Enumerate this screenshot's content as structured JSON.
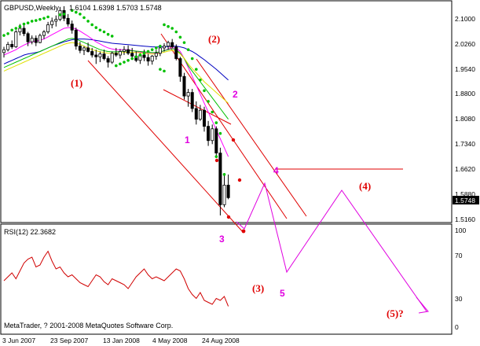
{
  "header": {
    "symbol": "GBPUSD,Weekly",
    "ohlc": "1.6104 1.6398 1.5703 1.5748"
  },
  "price_axis": {
    "ticks": [
      "2.1000",
      "2.0260",
      "1.9540",
      "1.8800",
      "1.8080",
      "1.7340",
      "1.6620",
      "1.5880",
      "1.5160"
    ],
    "current_price": "1.5748"
  },
  "rsi": {
    "label": "RSI(12) 22.3682",
    "ticks": [
      "100",
      "70",
      "30",
      "0"
    ]
  },
  "time_axis": {
    "labels": [
      "3 Jun 2007",
      "23 Sep 2007",
      "13 Jan 2008",
      "4 May 2008",
      "24 Aug 2008"
    ]
  },
  "copyright": "MetaTrader, ? 2001-2008 MetaQuotes Software Corp.",
  "wave_labels": {
    "red": [
      "(1)",
      "(2)",
      "(3)",
      "(4)",
      "(5)?"
    ],
    "magenta": [
      "1",
      "2",
      "3",
      "4",
      "5"
    ]
  },
  "colors": {
    "bull_candle": "#ffffff",
    "bear_candle": "#000000",
    "channel": "#e00000",
    "projection": "#e000e0",
    "sar": "#00c000",
    "rsi_line": "#d00000",
    "ma_blue": "#0000c0",
    "ma_magenta": "#ff00ff",
    "ma_green": "#00c000",
    "ma_yellow": "#e0e000",
    "current_price_box": "#000000"
  },
  "chart_data": {
    "type": "candlestick",
    "instrument": "GBPUSD",
    "timeframe": "Weekly",
    "last_bar": {
      "open": 1.6104,
      "high": 1.6398,
      "low": 1.5703,
      "close": 1.5748
    },
    "ylim": [
      1.505,
      2.125
    ],
    "candles": [
      [
        1.982,
        1.998,
        1.968,
        1.99
      ],
      [
        1.99,
        2.012,
        1.985,
        2.005
      ],
      [
        2.005,
        2.016,
        1.992,
        1.998
      ],
      [
        1.998,
        2.045,
        1.995,
        2.04
      ],
      [
        2.04,
        2.062,
        2.03,
        2.05
      ],
      [
        2.05,
        2.06,
        2.028,
        2.035
      ],
      [
        2.035,
        2.04,
        2.0,
        2.012
      ],
      [
        2.012,
        2.03,
        2.005,
        2.022
      ],
      [
        2.022,
        2.03,
        2.0,
        2.01
      ],
      [
        2.01,
        2.035,
        2.008,
        2.03
      ],
      [
        2.03,
        2.045,
        2.02,
        2.04
      ],
      [
        2.04,
        2.068,
        2.035,
        2.06
      ],
      [
        2.06,
        2.08,
        2.05,
        2.07
      ],
      [
        2.07,
        2.086,
        2.055,
        2.075
      ],
      [
        2.075,
        2.11,
        2.07,
        2.1
      ],
      [
        2.1,
        2.112,
        2.07,
        2.078
      ],
      [
        2.078,
        2.09,
        2.055,
        2.062
      ],
      [
        2.062,
        2.072,
        2.035,
        2.045
      ],
      [
        2.045,
        2.052,
        1.99,
        2.0
      ],
      [
        2.0,
        2.012,
        1.98,
        1.988
      ],
      [
        1.988,
        2.0,
        1.975,
        1.995
      ],
      [
        1.995,
        2.01,
        1.982,
        1.985
      ],
      [
        1.985,
        1.995,
        1.968,
        1.975
      ],
      [
        1.975,
        1.99,
        1.95,
        1.97
      ],
      [
        1.97,
        1.985,
        1.955,
        1.978
      ],
      [
        1.978,
        1.99,
        1.96,
        1.965
      ],
      [
        1.965,
        1.972,
        1.94,
        1.955
      ],
      [
        1.955,
        1.985,
        1.95,
        1.98
      ],
      [
        1.98,
        1.995,
        1.97,
        1.975
      ],
      [
        1.975,
        1.992,
        1.965,
        1.985
      ],
      [
        1.985,
        2.0,
        1.975,
        1.99
      ],
      [
        1.99,
        2.002,
        1.975,
        1.98
      ],
      [
        1.98,
        1.995,
        1.965,
        1.972
      ],
      [
        1.972,
        1.985,
        1.955,
        1.96
      ],
      [
        1.96,
        1.98,
        1.95,
        1.975
      ],
      [
        1.975,
        1.99,
        1.958,
        1.968
      ],
      [
        1.968,
        1.978,
        1.945,
        1.958
      ],
      [
        1.958,
        1.975,
        1.948,
        1.972
      ],
      [
        1.972,
        1.99,
        1.962,
        1.98
      ],
      [
        1.98,
        2.0,
        1.972,
        1.995
      ],
      [
        1.995,
        2.008,
        1.985,
        2.0
      ],
      [
        2.0,
        2.015,
        1.99,
        2.01
      ],
      [
        2.01,
        2.02,
        1.995,
        1.998
      ],
      [
        1.998,
        2.005,
        1.96,
        1.965
      ],
      [
        1.965,
        1.97,
        1.9,
        1.915
      ],
      [
        1.915,
        1.925,
        1.85,
        1.86
      ],
      [
        1.86,
        1.88,
        1.83,
        1.87
      ],
      [
        1.87,
        1.88,
        1.815,
        1.825
      ],
      [
        1.825,
        1.845,
        1.78,
        1.795
      ],
      [
        1.795,
        1.835,
        1.79,
        1.82
      ],
      [
        1.82,
        1.83,
        1.76,
        1.775
      ],
      [
        1.775,
        1.79,
        1.72,
        1.735
      ],
      [
        1.735,
        1.78,
        1.725,
        1.768
      ],
      [
        1.768,
        1.775,
        1.69,
        1.7
      ],
      [
        1.7,
        1.715,
        1.525,
        1.555
      ],
      [
        1.555,
        1.64,
        1.548,
        1.61
      ],
      [
        1.61,
        1.6398,
        1.5703,
        1.5748
      ]
    ],
    "ma_lines": [
      {
        "name": "ma-blue",
        "color": "#0000c0",
        "values": [
          1.95,
          1.955,
          1.96,
          1.965,
          1.97,
          1.975,
          1.978,
          1.98,
          1.982,
          1.985,
          1.99,
          1.995,
          2.0,
          2.004,
          2.008,
          2.012,
          2.015,
          2.018,
          2.02,
          2.02,
          2.02,
          2.019,
          2.018,
          2.016,
          2.014,
          2.012,
          2.01,
          2.008,
          2.007,
          2.006,
          2.005,
          2.004,
          2.003,
          2.002,
          2.001,
          2.0,
          1.999,
          1.998,
          1.998,
          1.998,
          1.998,
          1.999,
          2.0,
          2.0,
          1.998,
          1.995,
          1.99,
          1.985,
          1.978,
          1.97,
          1.962,
          1.953,
          1.944,
          1.935,
          1.925,
          1.915,
          1.905
        ]
      },
      {
        "name": "ma-magenta",
        "color": "#ff00ff",
        "values": [
          1.975,
          1.98,
          1.985,
          1.99,
          1.997,
          2.003,
          2.008,
          2.012,
          2.014,
          2.016,
          2.02,
          2.026,
          2.032,
          2.038,
          2.044,
          2.05,
          2.052,
          2.052,
          2.048,
          2.042,
          2.035,
          2.028,
          2.02,
          2.012,
          2.006,
          2.0,
          1.995,
          1.992,
          1.99,
          1.99,
          1.99,
          1.99,
          1.988,
          1.985,
          1.983,
          1.982,
          1.98,
          1.979,
          1.98,
          1.983,
          1.987,
          1.992,
          1.995,
          1.995,
          1.985,
          1.965,
          1.94,
          1.915,
          1.89,
          1.865,
          1.84,
          1.815,
          1.79,
          1.765,
          1.74,
          1.715,
          1.69
        ]
      },
      {
        "name": "ma-green",
        "color": "#00c000",
        "values": [
          1.94,
          1.945,
          1.95,
          1.955,
          1.96,
          1.965,
          1.97,
          1.975,
          1.98,
          1.985,
          1.99,
          1.995,
          2.0,
          2.005,
          2.01,
          2.015,
          2.02,
          2.022,
          2.02,
          2.015,
          2.01,
          2.005,
          2.0,
          1.995,
          1.99,
          1.987,
          1.985,
          1.984,
          1.984,
          1.985,
          1.986,
          1.987,
          1.987,
          1.986,
          1.985,
          1.984,
          1.983,
          1.982,
          1.982,
          1.984,
          1.987,
          1.99,
          1.993,
          1.99,
          1.98,
          1.965,
          1.945,
          1.93,
          1.915,
          1.9,
          1.885,
          1.87,
          1.855,
          1.84,
          1.825,
          1.81,
          1.795
        ]
      },
      {
        "name": "ma-yellow",
        "color": "#e0e000",
        "values": [
          1.93,
          1.935,
          1.94,
          1.945,
          1.95,
          1.955,
          1.96,
          1.965,
          1.97,
          1.975,
          1.98,
          1.985,
          1.99,
          1.995,
          2.0,
          2.005,
          2.008,
          2.01,
          2.008,
          2.005,
          2.0,
          1.995,
          1.99,
          1.987,
          1.984,
          1.982,
          1.98,
          1.98,
          1.98,
          1.981,
          1.982,
          1.983,
          1.983,
          1.982,
          1.981,
          1.98,
          1.979,
          1.978,
          1.978,
          1.98,
          1.983,
          1.986,
          1.988,
          1.986,
          1.978,
          1.966,
          1.95,
          1.937,
          1.925,
          1.913,
          1.9,
          1.89,
          1.88,
          1.87,
          1.86,
          1.85,
          1.84
        ]
      }
    ],
    "sar": [
      [
        0,
        2.03
      ],
      [
        1,
        2.035
      ],
      [
        2,
        2.045
      ],
      [
        3,
        2.05
      ],
      [
        4,
        2.055
      ],
      [
        5,
        2.062
      ],
      [
        6,
        2.065
      ],
      [
        7,
        2.07
      ],
      [
        8,
        2.072
      ],
      [
        9,
        2.075
      ],
      [
        10,
        2.078
      ],
      [
        11,
        2.082
      ],
      [
        14,
        2.088
      ],
      [
        15,
        2.09
      ],
      [
        17,
        2.1
      ],
      [
        18,
        2.095
      ],
      [
        19,
        2.09
      ],
      [
        20,
        2.08
      ],
      [
        21,
        2.07
      ],
      [
        22,
        2.06
      ],
      [
        23,
        2.052
      ],
      [
        24,
        2.045
      ],
      [
        25,
        2.04
      ],
      [
        26,
        2.033
      ],
      [
        27,
        2.028
      ],
      [
        28,
        1.945
      ],
      [
        29,
        1.95
      ],
      [
        30,
        1.955
      ],
      [
        31,
        1.96
      ],
      [
        32,
        1.965
      ],
      [
        33,
        1.97
      ],
      [
        34,
        1.975
      ],
      [
        35,
        1.98
      ],
      [
        36,
        1.985
      ],
      [
        37,
        1.99
      ],
      [
        38,
        1.995
      ],
      [
        39,
        2.0
      ],
      [
        40,
        2.06
      ],
      [
        41,
        2.055
      ],
      [
        42,
        2.05
      ],
      [
        43,
        2.04
      ],
      [
        44,
        2.025
      ],
      [
        45,
        2.01
      ],
      [
        46,
        1.99
      ],
      [
        47,
        1.965
      ],
      [
        48,
        1.935
      ],
      [
        49,
        1.905
      ],
      [
        50,
        1.875
      ],
      [
        51,
        1.845
      ],
      [
        52,
        1.815
      ],
      [
        53,
        1.785
      ],
      [
        54,
        1.755
      ],
      [
        39,
        1.935
      ],
      [
        40,
        1.93
      ],
      [
        53,
        1.69
      ],
      [
        55,
        1.64
      ]
    ],
    "rsi_values": [
      48,
      52,
      56,
      50,
      58,
      66,
      70,
      72,
      62,
      64,
      72,
      78,
      68,
      60,
      62,
      56,
      52,
      54,
      50,
      46,
      44,
      42,
      48,
      54,
      52,
      47,
      44,
      50,
      48,
      46,
      44,
      40,
      46,
      52,
      56,
      60,
      54,
      50,
      52,
      50,
      48,
      52,
      56,
      60,
      58,
      50,
      40,
      34,
      30,
      36,
      28,
      26,
      24,
      30,
      28,
      32,
      22
    ],
    "rsi_ylim": [
      0,
      100
    ]
  }
}
